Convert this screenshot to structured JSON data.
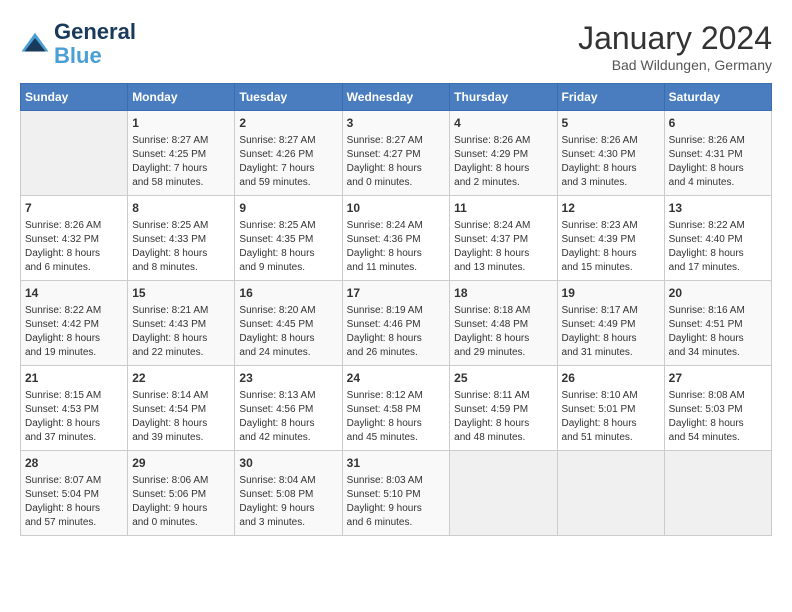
{
  "header": {
    "logo_line1": "General",
    "logo_line2": "Blue",
    "month": "January 2024",
    "location": "Bad Wildungen, Germany"
  },
  "days_of_week": [
    "Sunday",
    "Monday",
    "Tuesday",
    "Wednesday",
    "Thursday",
    "Friday",
    "Saturday"
  ],
  "weeks": [
    [
      {
        "day": "",
        "info": ""
      },
      {
        "day": "1",
        "info": "Sunrise: 8:27 AM\nSunset: 4:25 PM\nDaylight: 7 hours\nand 58 minutes."
      },
      {
        "day": "2",
        "info": "Sunrise: 8:27 AM\nSunset: 4:26 PM\nDaylight: 7 hours\nand 59 minutes."
      },
      {
        "day": "3",
        "info": "Sunrise: 8:27 AM\nSunset: 4:27 PM\nDaylight: 8 hours\nand 0 minutes."
      },
      {
        "day": "4",
        "info": "Sunrise: 8:26 AM\nSunset: 4:29 PM\nDaylight: 8 hours\nand 2 minutes."
      },
      {
        "day": "5",
        "info": "Sunrise: 8:26 AM\nSunset: 4:30 PM\nDaylight: 8 hours\nand 3 minutes."
      },
      {
        "day": "6",
        "info": "Sunrise: 8:26 AM\nSunset: 4:31 PM\nDaylight: 8 hours\nand 4 minutes."
      }
    ],
    [
      {
        "day": "7",
        "info": "Sunrise: 8:26 AM\nSunset: 4:32 PM\nDaylight: 8 hours\nand 6 minutes."
      },
      {
        "day": "8",
        "info": "Sunrise: 8:25 AM\nSunset: 4:33 PM\nDaylight: 8 hours\nand 8 minutes."
      },
      {
        "day": "9",
        "info": "Sunrise: 8:25 AM\nSunset: 4:35 PM\nDaylight: 8 hours\nand 9 minutes."
      },
      {
        "day": "10",
        "info": "Sunrise: 8:24 AM\nSunset: 4:36 PM\nDaylight: 8 hours\nand 11 minutes."
      },
      {
        "day": "11",
        "info": "Sunrise: 8:24 AM\nSunset: 4:37 PM\nDaylight: 8 hours\nand 13 minutes."
      },
      {
        "day": "12",
        "info": "Sunrise: 8:23 AM\nSunset: 4:39 PM\nDaylight: 8 hours\nand 15 minutes."
      },
      {
        "day": "13",
        "info": "Sunrise: 8:22 AM\nSunset: 4:40 PM\nDaylight: 8 hours\nand 17 minutes."
      }
    ],
    [
      {
        "day": "14",
        "info": "Sunrise: 8:22 AM\nSunset: 4:42 PM\nDaylight: 8 hours\nand 19 minutes."
      },
      {
        "day": "15",
        "info": "Sunrise: 8:21 AM\nSunset: 4:43 PM\nDaylight: 8 hours\nand 22 minutes."
      },
      {
        "day": "16",
        "info": "Sunrise: 8:20 AM\nSunset: 4:45 PM\nDaylight: 8 hours\nand 24 minutes."
      },
      {
        "day": "17",
        "info": "Sunrise: 8:19 AM\nSunset: 4:46 PM\nDaylight: 8 hours\nand 26 minutes."
      },
      {
        "day": "18",
        "info": "Sunrise: 8:18 AM\nSunset: 4:48 PM\nDaylight: 8 hours\nand 29 minutes."
      },
      {
        "day": "19",
        "info": "Sunrise: 8:17 AM\nSunset: 4:49 PM\nDaylight: 8 hours\nand 31 minutes."
      },
      {
        "day": "20",
        "info": "Sunrise: 8:16 AM\nSunset: 4:51 PM\nDaylight: 8 hours\nand 34 minutes."
      }
    ],
    [
      {
        "day": "21",
        "info": "Sunrise: 8:15 AM\nSunset: 4:53 PM\nDaylight: 8 hours\nand 37 minutes."
      },
      {
        "day": "22",
        "info": "Sunrise: 8:14 AM\nSunset: 4:54 PM\nDaylight: 8 hours\nand 39 minutes."
      },
      {
        "day": "23",
        "info": "Sunrise: 8:13 AM\nSunset: 4:56 PM\nDaylight: 8 hours\nand 42 minutes."
      },
      {
        "day": "24",
        "info": "Sunrise: 8:12 AM\nSunset: 4:58 PM\nDaylight: 8 hours\nand 45 minutes."
      },
      {
        "day": "25",
        "info": "Sunrise: 8:11 AM\nSunset: 4:59 PM\nDaylight: 8 hours\nand 48 minutes."
      },
      {
        "day": "26",
        "info": "Sunrise: 8:10 AM\nSunset: 5:01 PM\nDaylight: 8 hours\nand 51 minutes."
      },
      {
        "day": "27",
        "info": "Sunrise: 8:08 AM\nSunset: 5:03 PM\nDaylight: 8 hours\nand 54 minutes."
      }
    ],
    [
      {
        "day": "28",
        "info": "Sunrise: 8:07 AM\nSunset: 5:04 PM\nDaylight: 8 hours\nand 57 minutes."
      },
      {
        "day": "29",
        "info": "Sunrise: 8:06 AM\nSunset: 5:06 PM\nDaylight: 9 hours\nand 0 minutes."
      },
      {
        "day": "30",
        "info": "Sunrise: 8:04 AM\nSunset: 5:08 PM\nDaylight: 9 hours\nand 3 minutes."
      },
      {
        "day": "31",
        "info": "Sunrise: 8:03 AM\nSunset: 5:10 PM\nDaylight: 9 hours\nand 6 minutes."
      },
      {
        "day": "",
        "info": ""
      },
      {
        "day": "",
        "info": ""
      },
      {
        "day": "",
        "info": ""
      }
    ]
  ]
}
